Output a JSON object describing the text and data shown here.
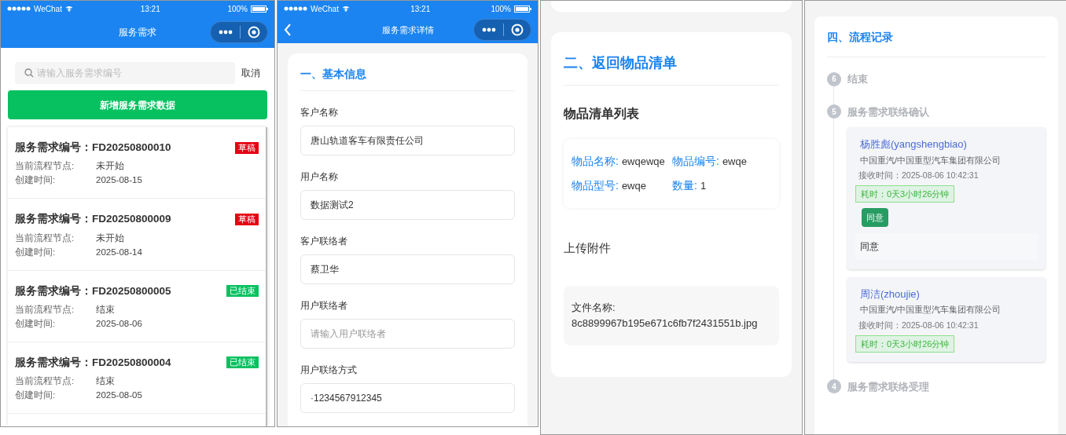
{
  "list_screen": {
    "status_bar": {
      "carrier": "WeChat",
      "time": "13:21",
      "battery": "100%"
    },
    "nav_title": "服务需求",
    "search": {
      "placeholder": "请输入服务需求编号"
    },
    "cancel": "取消",
    "add_button": "新增服务需求数据",
    "requests": [
      {
        "title": "服务需求编号：FD20250800010",
        "status": {
          "kind": "draft",
          "label": "草稿"
        },
        "node_label": "当前流程节点:",
        "node": "未开始",
        "created_label": "创建时间:",
        "created": "2025-08-15"
      },
      {
        "title": "服务需求编号：FD20250800009",
        "status": {
          "kind": "draft",
          "label": "草稿"
        },
        "node_label": "当前流程节点:",
        "node": "未开始",
        "created_label": "创建时间:",
        "created": "2025-08-14"
      },
      {
        "title": "服务需求编号：FD20250800005",
        "status": {
          "kind": "done",
          "label": "已结束"
        },
        "node_label": "当前流程节点:",
        "node": "结束",
        "created_label": "创建时间:",
        "created": "2025-08-06"
      },
      {
        "title": "服务需求编号：FD20250800004",
        "status": {
          "kind": "done",
          "label": "已结束"
        },
        "node_label": "当前流程节点:",
        "node": "结束",
        "created_label": "创建时间:",
        "created": "2025-08-05"
      }
    ]
  },
  "detail_screen": {
    "status_bar": {
      "carrier": "WeChat",
      "time": "13:21",
      "battery": "100%"
    },
    "nav_title": "服务需求详情",
    "section_title": "一、基本信息",
    "fields": [
      {
        "label": "客户名称",
        "value": "唐山轨道客车有限责任公司"
      },
      {
        "label": "用户名称",
        "value": "数据测试2"
      },
      {
        "label": "客户联络者",
        "value": "蔡卫华"
      },
      {
        "label": "用户联络者",
        "placeholder": "请输入用户联络者"
      },
      {
        "label": "用户联络方式",
        "value": "·1234567912345"
      }
    ]
  },
  "items_screen": {
    "section_title": "二、返回物品清单",
    "list_title": "物品清单列表",
    "item": [
      {
        "label": "物品名称:",
        "value": "ewqewqe"
      },
      {
        "label": "物品编号:",
        "value": "ewqe"
      },
      {
        "label": "物品型号:",
        "value": "ewqe"
      },
      {
        "label": "数量:",
        "value": "1"
      }
    ],
    "upload_label": "上传附件",
    "file_label": "文件名称:",
    "file_name": "8c8899967b195e671c6fb7f2431551b.jpg"
  },
  "process_screen": {
    "section_title": "四、流程记录",
    "steps": [
      {
        "number": "6",
        "title": "结束"
      },
      {
        "number": "5",
        "title": "服务需求联络确认",
        "records": [
          {
            "name": "杨胜彪(yangshengbiao)",
            "org": "中国重汽/中国重型汽车集团有限公司",
            "received": "接收时间：2025-08-06 10:42:31",
            "duration": "耗时：0天3小时26分钟",
            "decision": "同意",
            "comment": "同意"
          },
          {
            "name": "周洁(zhoujie)",
            "org": "中国重汽/中国重型汽车集团有限公司",
            "received": "接收时间：2025-08-06 10:42:31",
            "duration": "耗时：0天3小时26分钟"
          }
        ]
      },
      {
        "number": "4",
        "title": "服务需求联络受理"
      }
    ]
  }
}
